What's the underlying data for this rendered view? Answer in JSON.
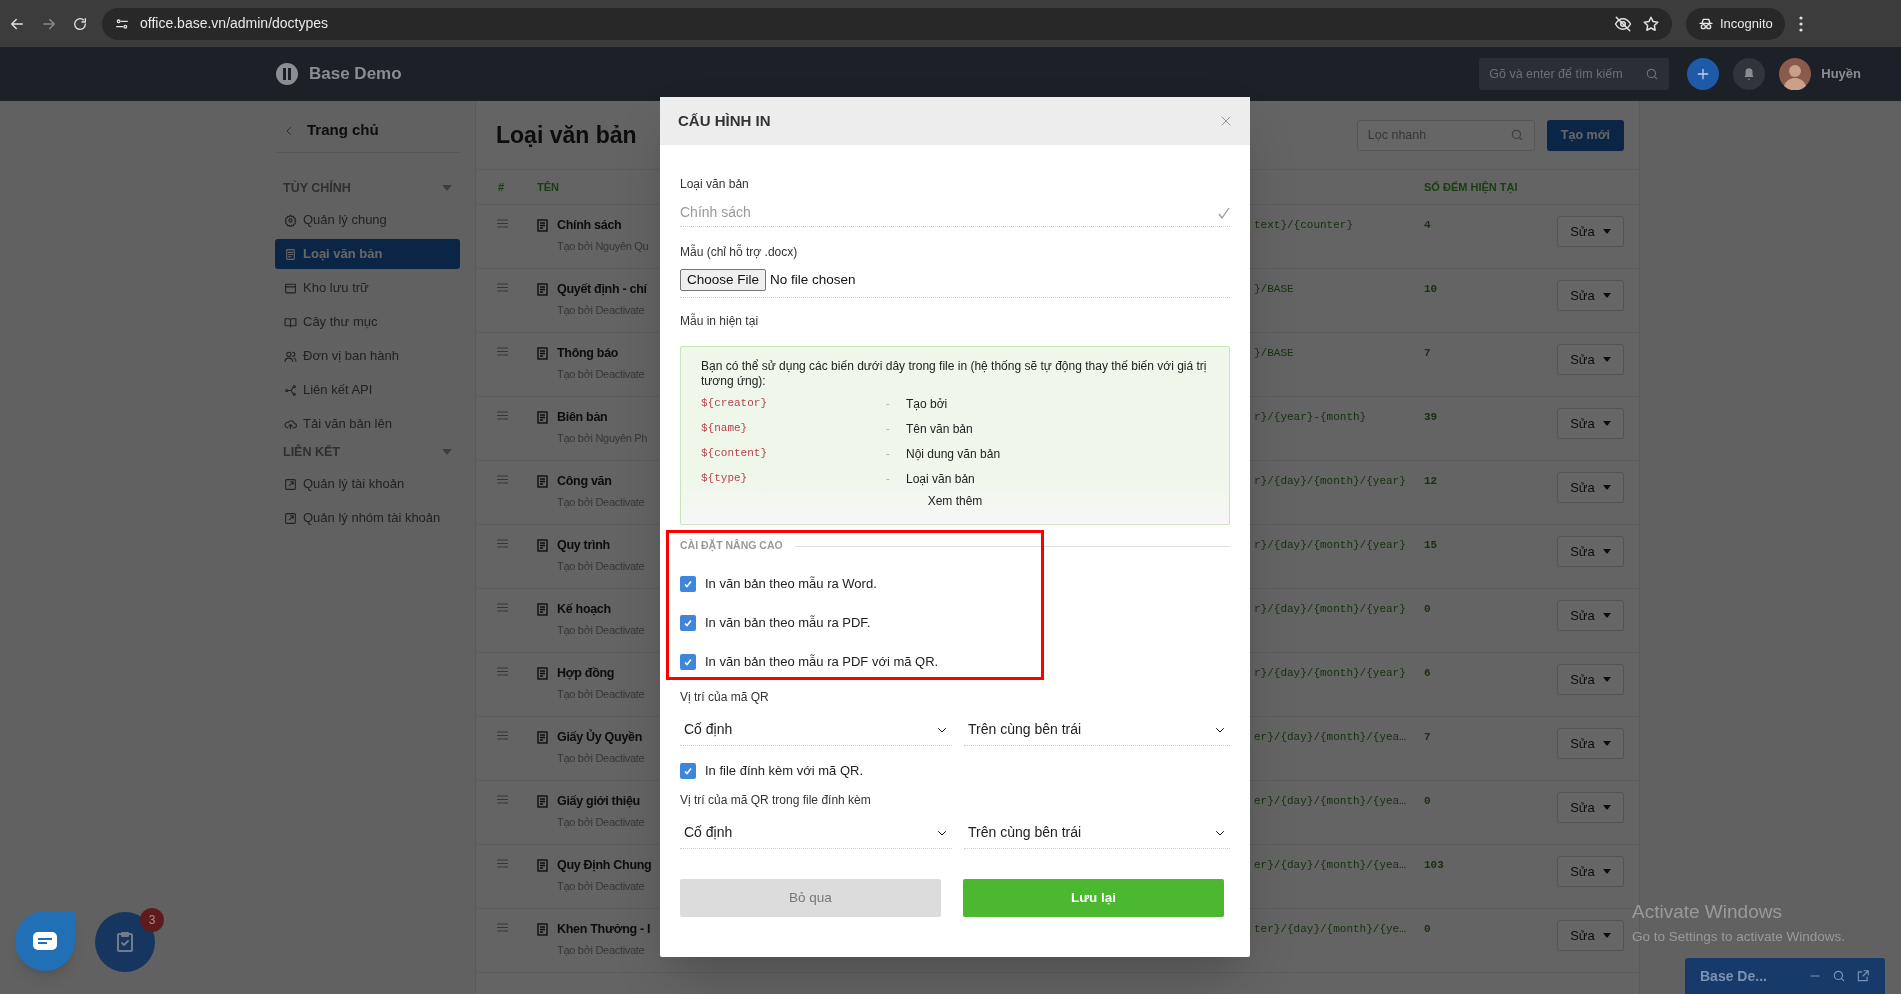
{
  "browser": {
    "url": "office.base.vn/admin/doctypes",
    "profile": "Incognito"
  },
  "app": {
    "brand": "Base Demo",
    "search_placeholder": "Gõ và enter để tìm kiếm",
    "user": "Huyền"
  },
  "sidebar": {
    "back": "Trang chủ",
    "sections": [
      {
        "title": "TÙY CHỈNH",
        "expanded": true,
        "items": [
          {
            "label": "Quản lý chung",
            "selected": false
          },
          {
            "label": "Loại văn bản",
            "selected": true
          },
          {
            "label": "Kho lưu trữ",
            "selected": false
          },
          {
            "label": "Cây thư mục",
            "selected": false
          },
          {
            "label": "Đơn vị ban hành",
            "selected": false
          },
          {
            "label": "Liên kết API",
            "selected": false
          },
          {
            "label": "Tải văn bản lên",
            "selected": false
          }
        ]
      },
      {
        "title": "LIÊN KẾT",
        "expanded": true,
        "items": [
          {
            "label": "Quản lý tài khoản",
            "selected": false
          },
          {
            "label": "Quản lý nhóm tài khoản",
            "selected": false
          }
        ]
      }
    ]
  },
  "page": {
    "title": "Loại văn bản",
    "filter_placeholder": "Lọc nhanh",
    "create_button": "Tạo mới"
  },
  "table": {
    "columns": [
      "#",
      "TÊN",
      "SỐ ĐẾM HIỆN TẠI"
    ],
    "rows": [
      {
        "name": "Chính sách",
        "creator": "Tạo bởi Nguyên Qu",
        "pattern": "text}/{counter}",
        "counter": "4",
        "action": "Sửa"
      },
      {
        "name": "Quyết định - chí",
        "creator": "Tạo bởi Deactivate",
        "pattern": "}/BASE",
        "counter": "10",
        "action": "Sửa"
      },
      {
        "name": "Thông báo",
        "creator": "Tạo bởi Deactivate",
        "pattern": "}/BASE",
        "counter": "7",
        "action": "Sửa"
      },
      {
        "name": "Biên bản",
        "creator": "Tạo bởi Nguyên Ph",
        "pattern": "r}/{year}-{month}",
        "counter": "39",
        "action": "Sửa"
      },
      {
        "name": "Công văn",
        "creator": "Tạo bởi Deactivate",
        "pattern": "r}/{day}/{month}/{year}",
        "counter": "12",
        "action": "Sửa"
      },
      {
        "name": "Quy trình",
        "creator": "Tạo bởi Deactivate",
        "pattern": "r}/{day}/{month}/{year}",
        "counter": "15",
        "action": "Sửa"
      },
      {
        "name": "Kế hoạch",
        "creator": "Tạo bởi Deactivate",
        "pattern": "r}/{day}/{month}/{year}",
        "counter": "0",
        "action": "Sửa"
      },
      {
        "name": "Hợp đồng",
        "creator": "Tạo bởi Deactivate",
        "pattern": "r}/{day}/{month}/{year}",
        "counter": "6",
        "action": "Sửa"
      },
      {
        "name": "Giấy Ủy Quyền",
        "creator": "Tạo bởi Deactivate",
        "pattern": "er}/{day}/{month}/{yea…",
        "counter": "7",
        "action": "Sửa"
      },
      {
        "name": "Giấy giới thiệu",
        "creator": "Tạo bởi Deactivate",
        "pattern": "er}/{day}/{month}/{yea…",
        "counter": "0",
        "action": "Sửa"
      },
      {
        "name": "Quy Định Chung",
        "creator": "Tạo bởi Deactivate",
        "pattern": "er}/{day}/{month}/{yea…",
        "counter": "103",
        "action": "Sửa"
      },
      {
        "name": "Khen Thưởng - I",
        "creator": "Tạo bởi Deactivate",
        "pattern": "ter}/{day}/{month}/{ye…",
        "counter": "0",
        "action": "Sửa"
      }
    ]
  },
  "modal": {
    "title": "CẤU HÌNH IN",
    "doc_type": {
      "label": "Loại văn bản",
      "value": "Chính sách"
    },
    "template": {
      "label": "Mẫu (chỉ hỗ trợ .docx)",
      "button": "Choose File",
      "status": "No file chosen"
    },
    "current_label": "Mẫu in hiện tại",
    "info": {
      "intro": "Bạn có thể sử dụng các biến dưới dây trong file in (hệ thống sẽ tự động thay thế biến với giá trị tương ứng):",
      "variables": [
        {
          "code": "${creator}",
          "separator": "-",
          "desc": "Tạo bởi"
        },
        {
          "code": "${name}",
          "separator": "-",
          "desc": "Tên văn bản"
        },
        {
          "code": "${content}",
          "separator": "-",
          "desc": "Nội dung văn bản"
        },
        {
          "code": "${type}",
          "separator": "-",
          "desc": "Loại văn bản"
        }
      ],
      "more": "Xem thêm"
    },
    "advanced": {
      "title": "CÀI ĐẶT NÂNG CAO",
      "highlighted": true,
      "options": [
        {
          "label": "In văn bản theo mẫu ra Word.",
          "checked": true
        },
        {
          "label": "In văn bản theo mẫu ra PDF.",
          "checked": true
        },
        {
          "label": "In văn bản theo mẫu ra PDF với mã QR.",
          "checked": true
        }
      ]
    },
    "qr_position": {
      "label": "Vị trí của mã QR",
      "selects": [
        "Cố định",
        "Trên cùng bên trái"
      ]
    },
    "attach_option": {
      "label": "In file đính kèm với mã QR.",
      "checked": true
    },
    "attach_position": {
      "label": "Vị trí của mã QR trong file đính kèm",
      "selects": [
        "Cố định",
        "Trên cùng bên trái"
      ]
    },
    "cancel": "Bỏ qua",
    "save": "Lưu lại"
  },
  "widgets": {
    "task_badge": "3",
    "chat_title": "Base De..."
  },
  "os_notice": {
    "title": "Activate Windows",
    "subtitle": "Go to Settings to activate Windows."
  }
}
